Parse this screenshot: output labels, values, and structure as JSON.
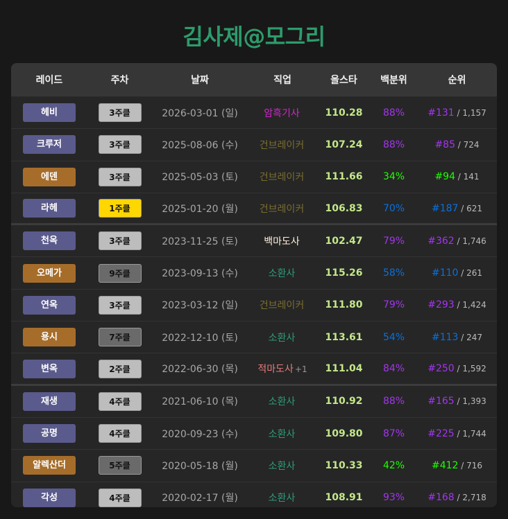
{
  "title": "김사제@모그리",
  "colors": {
    "title": "#2e9b6c",
    "raid_purple": "#5a5a8c",
    "raid_orange": "#a56c2a",
    "week_light": "#bdbdbd",
    "week_dark": "#6a6a6a",
    "week_gold": "#ffd700",
    "score": "#c2e88a",
    "pct_purple": "#a335ee",
    "pct_blue": "#0a70dd",
    "pct_green": "#1eff00"
  },
  "headers": [
    "레이드",
    "주차",
    "날짜",
    "직업",
    "올스타",
    "백분위",
    "순위"
  ],
  "rows": [
    {
      "raid": "헤비",
      "raid_color": "#5a5a8c",
      "week": "3주클",
      "week_bg": "#bdbdbd",
      "date": "2026-03-01 (일)",
      "job": "암흑기사",
      "job_color": "#d126cc",
      "job_extra": "",
      "score": "110.28",
      "pct": "88%",
      "pct_color": "#a335ee",
      "rank": "#131",
      "total": " / 1,157"
    },
    {
      "raid": "크루저",
      "raid_color": "#5a5a8c",
      "week": "3주클",
      "week_bg": "#bdbdbd",
      "date": "2025-08-06 (수)",
      "job": "건브레이커",
      "job_color": "#796d30",
      "job_extra": "",
      "score": "107.24",
      "pct": "88%",
      "pct_color": "#a335ee",
      "rank": "#85",
      "total": " / 724"
    },
    {
      "raid": "에덴",
      "raid_color": "#a56c2a",
      "week": "3주클",
      "week_bg": "#bdbdbd",
      "date": "2025-05-03 (토)",
      "job": "건브레이커",
      "job_color": "#796d30",
      "job_extra": "",
      "score": "111.66",
      "pct": "34%",
      "pct_color": "#1eff00",
      "rank": "#94",
      "total": " / 141"
    },
    {
      "raid": "라헤",
      "raid_color": "#5a5a8c",
      "week": "1주클",
      "week_bg": "#ffd700",
      "date": "2025-01-20 (월)",
      "job": "건브레이커",
      "job_color": "#796d30",
      "job_extra": "",
      "score": "106.83",
      "pct": "70%",
      "pct_color": "#0a70dd",
      "rank": "#187",
      "total": " / 621",
      "sep": true
    },
    {
      "raid": "천옥",
      "raid_color": "#5a5a8c",
      "week": "3주클",
      "week_bg": "#bdbdbd",
      "date": "2023-11-25 (토)",
      "job": "백마도사",
      "job_color": "#fff0dc",
      "job_extra": "",
      "score": "102.47",
      "pct": "79%",
      "pct_color": "#a335ee",
      "rank": "#362",
      "total": " / 1,746"
    },
    {
      "raid": "오메가",
      "raid_color": "#a56c2a",
      "week": "9주클",
      "week_bg": "#6a6a6a",
      "date": "2023-09-13 (수)",
      "job": "소환사",
      "job_color": "#2d9b78",
      "job_extra": "",
      "score": "115.26",
      "pct": "58%",
      "pct_color": "#0a70dd",
      "rank": "#110",
      "total": " / 261"
    },
    {
      "raid": "연옥",
      "raid_color": "#5a5a8c",
      "week": "3주클",
      "week_bg": "#bdbdbd",
      "date": "2023-03-12 (일)",
      "job": "건브레이커",
      "job_color": "#796d30",
      "job_extra": "",
      "score": "111.80",
      "pct": "79%",
      "pct_color": "#a335ee",
      "rank": "#293",
      "total": " / 1,424"
    },
    {
      "raid": "용시",
      "raid_color": "#a56c2a",
      "week": "7주클",
      "week_bg": "#6a6a6a",
      "date": "2022-12-10 (토)",
      "job": "소환사",
      "job_color": "#2d9b78",
      "job_extra": "",
      "score": "113.61",
      "pct": "54%",
      "pct_color": "#0a70dd",
      "rank": "#113",
      "total": " / 247"
    },
    {
      "raid": "변옥",
      "raid_color": "#5a5a8c",
      "week": "2주클",
      "week_bg": "#bdbdbd",
      "date": "2022-06-30 (목)",
      "job": "적마도사",
      "job_color": "#e87b7b",
      "job_extra": "+1",
      "score": "111.04",
      "pct": "84%",
      "pct_color": "#a335ee",
      "rank": "#250",
      "total": " / 1,592",
      "sep": true
    },
    {
      "raid": "재생",
      "raid_color": "#5a5a8c",
      "week": "4주클",
      "week_bg": "#bdbdbd",
      "date": "2021-06-10 (목)",
      "job": "소환사",
      "job_color": "#2d9b78",
      "job_extra": "",
      "score": "110.92",
      "pct": "88%",
      "pct_color": "#a335ee",
      "rank": "#165",
      "total": " / 1,393"
    },
    {
      "raid": "공명",
      "raid_color": "#5a5a8c",
      "week": "4주클",
      "week_bg": "#bdbdbd",
      "date": "2020-09-23 (수)",
      "job": "소환사",
      "job_color": "#2d9b78",
      "job_extra": "",
      "score": "109.80",
      "pct": "87%",
      "pct_color": "#a335ee",
      "rank": "#225",
      "total": " / 1,744"
    },
    {
      "raid": "알렉산더",
      "raid_color": "#a56c2a",
      "week": "5주클",
      "week_bg": "#6a6a6a",
      "date": "2020-05-18 (월)",
      "job": "소환사",
      "job_color": "#2d9b78",
      "job_extra": "",
      "score": "110.33",
      "pct": "42%",
      "pct_color": "#1eff00",
      "rank": "#412",
      "total": " / 716"
    },
    {
      "raid": "각성",
      "raid_color": "#5a5a8c",
      "week": "4주클",
      "week_bg": "#bdbdbd",
      "date": "2020-02-17 (월)",
      "job": "소환사",
      "job_color": "#2d9b78",
      "job_extra": "",
      "score": "108.91",
      "pct": "93%",
      "pct_color": "#a335ee",
      "rank": "#168",
      "total": " / 2,718"
    }
  ]
}
